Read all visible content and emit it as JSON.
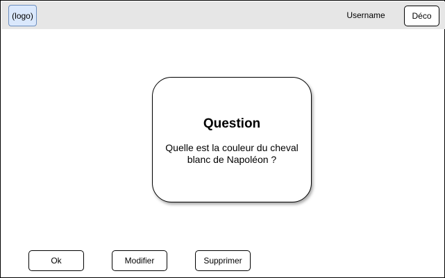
{
  "header": {
    "logo_label": "(logo)",
    "username": "Username",
    "logout_label": "Déco"
  },
  "question_card": {
    "title": "Question",
    "text": "Quelle est la couleur du cheval blanc de Napoléon ?"
  },
  "actions": {
    "ok_label": "Ok",
    "modify_label": "Modifier",
    "delete_label": "Supprimer"
  },
  "colors": {
    "header_bg": "#e6e6e6",
    "logo_bg": "#dae8fc",
    "logo_border": "#6c8ebf"
  }
}
